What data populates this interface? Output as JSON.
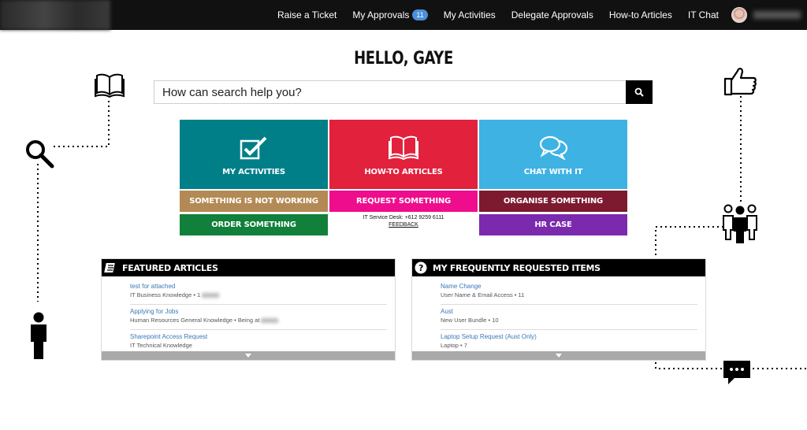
{
  "nav": {
    "items": [
      {
        "label": "Raise a Ticket"
      },
      {
        "label": "My Approvals",
        "badge": "11"
      },
      {
        "label": "My Activities"
      },
      {
        "label": "Delegate Approvals"
      },
      {
        "label": "How-to Articles"
      },
      {
        "label": "IT Chat"
      }
    ]
  },
  "greeting": "HELLO, GAYE",
  "search": {
    "placeholder": "How can search help you?"
  },
  "tiles": {
    "my_activities": "MY ACTIVITIES",
    "howto_articles": "HOW-TO ARTICLES",
    "chat_with_it": "CHAT WITH IT",
    "something_not_working": "SOMETHING IS NOT WORKING",
    "request_something": "REQUEST SOMETHING",
    "organise_something": "ORGANISE SOMETHING",
    "order_something": "ORDER SOMETHING",
    "hr_case": "HR CASE"
  },
  "service_desk": {
    "text": "IT Service Desk: +612 9259 6111",
    "feedback": "FEEDBACK"
  },
  "colors": {
    "teal": "#007f89",
    "red": "#e2213c",
    "sky": "#3fb2e4",
    "tan": "#b38a55",
    "magenta": "#ee0e8d",
    "maroon": "#7d1a2f",
    "green": "#10803a",
    "purple": "#7b2aad"
  },
  "featured": {
    "title": "FEATURED ARTICLES",
    "items": [
      {
        "title": "test for attached",
        "sub": "IT Business Knowledge • 1"
      },
      {
        "title": "Applying for Jobs",
        "sub": "Human Resources General Knowledge • Being at"
      },
      {
        "title": "Sharepoint Access Request",
        "sub": "IT Technical Knowledge"
      }
    ]
  },
  "frequent": {
    "title": "MY FREQUENTLY REQUESTED ITEMS",
    "items": [
      {
        "title": "Name Change",
        "sub": "User Name & Email Access • 11"
      },
      {
        "title": "Aust",
        "sub": "New User Bundle • 10"
      },
      {
        "title": "Laptop Setup Request (Aust Only)",
        "sub": "Laptop • 7"
      }
    ]
  },
  "icons": [
    "book-icon",
    "magnifier-icon",
    "thumbs-up-icon",
    "person-icon",
    "group-icon",
    "chat-bubble-icon",
    "checkbox-icon",
    "speech-bubbles-icon",
    "search-icon",
    "question-icon",
    "chevron-down-icon"
  ]
}
